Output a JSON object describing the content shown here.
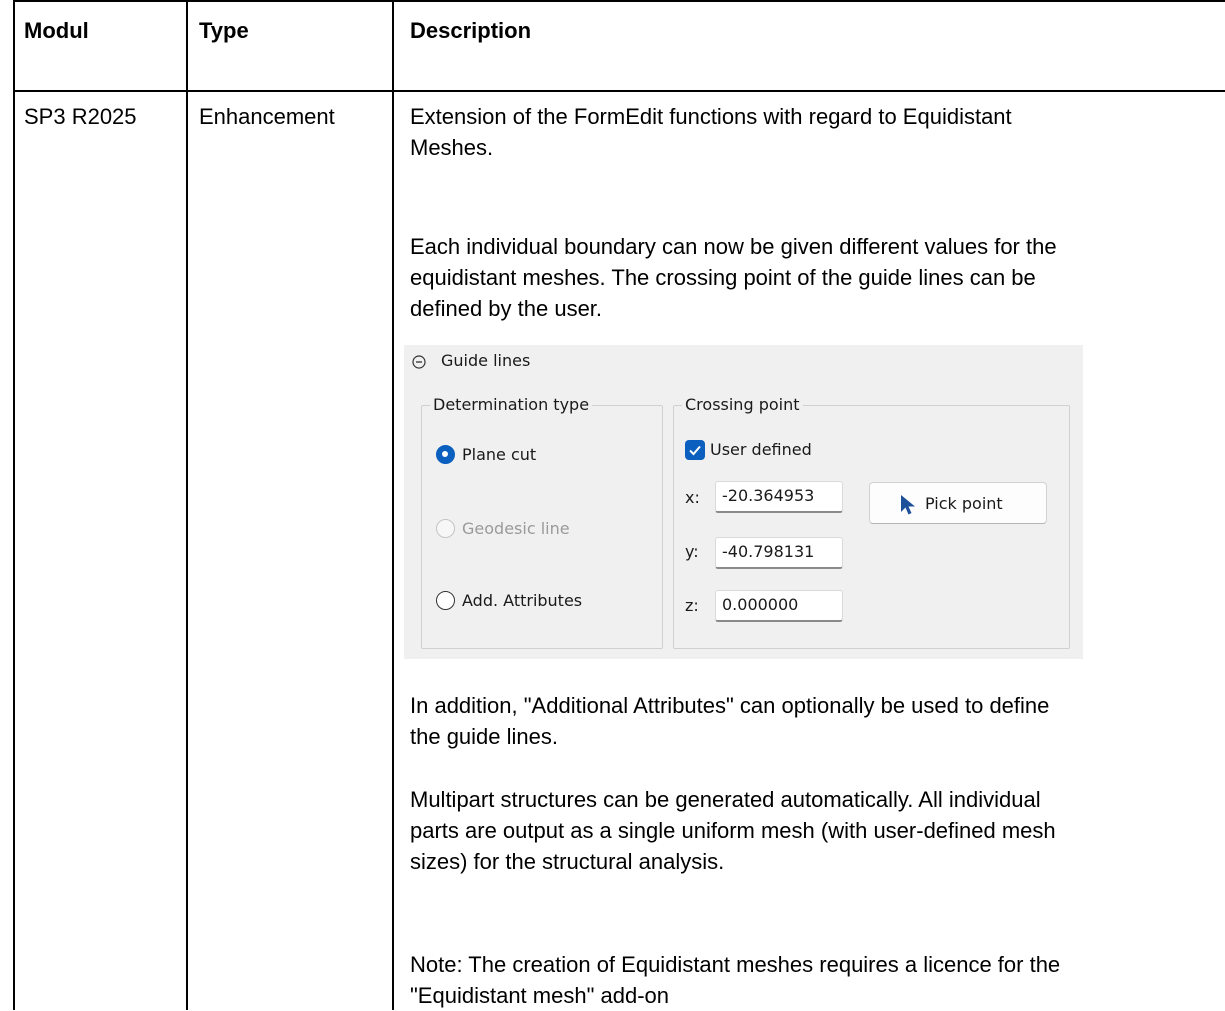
{
  "table": {
    "headers": [
      "Modul",
      "Type",
      "Description"
    ],
    "row": {
      "modul": "SP3 R2025",
      "type": "Enhancement",
      "paragraphs": [
        [
          "Extension of the FormEdit functions with regard to Equidistant",
          "Meshes."
        ],
        [
          "Each individual boundary can now be given different values for the",
          "equidistant meshes. The crossing point of the guide lines can be",
          "defined by the user."
        ],
        [
          "In addition, \"Additional Attributes\" can optionally be used to define",
          "the guide lines."
        ],
        [
          "Multipart structures can be generated automatically. All individual",
          "parts are output as a single uniform mesh (with user-defined mesh",
          "sizes) for the structural analysis."
        ],
        [
          "Note: The creation of Equidistant meshes requires a licence for the",
          "\"Equidistant mesh\" add-on"
        ]
      ]
    }
  },
  "dialog": {
    "section_title": "Guide lines",
    "determination": {
      "legend": "Determination type",
      "options": [
        {
          "label": "Plane cut",
          "selected": true,
          "enabled": true
        },
        {
          "label": "Geodesic line",
          "selected": false,
          "enabled": false
        },
        {
          "label": "Add. Attributes",
          "selected": false,
          "enabled": true
        }
      ]
    },
    "crossing": {
      "legend": "Crossing point",
      "checkbox_label": "User defined",
      "checkbox_checked": true,
      "fields": [
        {
          "label": "x:",
          "value": "-20.364953"
        },
        {
          "label": "y:",
          "value": "-40.798131"
        },
        {
          "label": "z:",
          "value": "0.000000"
        }
      ],
      "pick_button": "Pick point"
    }
  },
  "colors": {
    "accent": "#0a5fbf",
    "panel_bg": "#f0f0f0",
    "disabled_text": "#9a9a9a"
  },
  "icons": [
    "collapse-icon",
    "cursor-arrow-icon",
    "checkmark-icon"
  ]
}
